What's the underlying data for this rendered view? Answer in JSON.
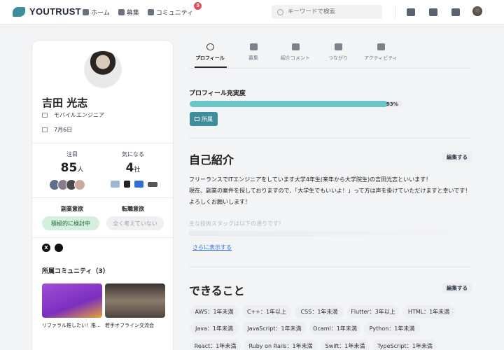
{
  "header": {
    "logo_text": "YOUTRUST",
    "nav": [
      {
        "label": "ホーム",
        "icon": "home-icon"
      },
      {
        "label": "募集",
        "icon": "briefcase-icon"
      },
      {
        "label": "コミュニティ",
        "icon": "people-icon",
        "badge": "5"
      }
    ],
    "search_placeholder": "キーワードで検索",
    "icons": [
      "add-person-icon",
      "bell-icon",
      "mail-icon"
    ]
  },
  "profile": {
    "name": "吉田 光志",
    "job": "モバイルエンジニア",
    "birthday": "7月6日",
    "stats": {
      "attention_label": "注目",
      "attention_count": "85",
      "attention_unit": "人",
      "interest_label": "気になる",
      "interest_count": "4",
      "interest_unit": "社"
    },
    "side_job_label": "副業意欲",
    "side_job_value": "積極的に検討中",
    "job_change_label": "転職意欲",
    "job_change_value": "全く考えていない",
    "sns": [
      "X",
      "GitHub"
    ],
    "communities_title": "所属コミュニティ（3）",
    "communities": [
      {
        "name": "リファラル推したい！推..."
      },
      {
        "name": "若手オフライン交流会"
      }
    ]
  },
  "tabs": [
    {
      "label": "プロフィール",
      "icon": "person-circle-icon",
      "active": true
    },
    {
      "label": "募集",
      "icon": "briefcase-icon"
    },
    {
      "label": "紹介コメント",
      "icon": "comment-icon"
    },
    {
      "label": "つながり",
      "icon": "people-icon"
    },
    {
      "label": "アクティビティ",
      "icon": "tag-icon"
    }
  ],
  "completeness": {
    "title": "プロフィール充実度",
    "percent_text": "93%",
    "fraction": 0.93,
    "tag_label": "所属"
  },
  "intro": {
    "title": "自己紹介",
    "edit_label": "編集する",
    "lines": [
      "フリーランスでITエンジニアをしています大学4年生(来年から大学院生)の吉田光志といいます！",
      "現在、副業の案件を探しておりますので、「大学生でもいいよ！」って方は声を掛けていただけますと幸いです！",
      "よろしくお願いします！"
    ],
    "faded_line": "主な技術スタックは以下の通りです！",
    "more_label": "さらに表示する"
  },
  "skills": {
    "title": "できること",
    "edit_label": "編集する",
    "rows": [
      [
        "AWS：1年未満",
        "C++：1年以上",
        "CSS：1年未満",
        "Flutter：3年以上",
        "HTML：1年未満"
      ],
      [
        "Java：1年未満",
        "JavaScript：1年未満",
        "Ocaml：1年未満",
        "Python：1年未満"
      ],
      [
        "React：1年未満",
        "Ruby on Rails：1年未満",
        "Swift：1年未満",
        "TypeScript：1年未満"
      ]
    ]
  },
  "colors": {
    "brand": "#3c8e9a",
    "progress": "#6cc5c7",
    "badge": "#e34b5a",
    "link": "#2f6fd6"
  }
}
